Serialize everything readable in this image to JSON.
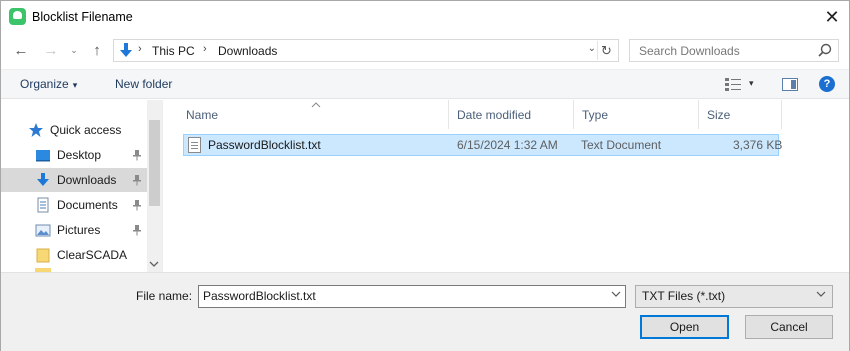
{
  "window": {
    "title": "Blocklist Filename",
    "close_glyph": "✕"
  },
  "nav": {
    "back_glyph": "←",
    "forward_glyph": "→",
    "up_glyph": "↑",
    "breadcrumb": [
      "This PC",
      "Downloads"
    ],
    "separator": "›",
    "refresh_glyph": "↻",
    "dropdown_glyph": "⌄"
  },
  "search": {
    "placeholder": "Search Downloads"
  },
  "toolbar": {
    "organize_label": "Organize",
    "new_folder_label": "New folder",
    "caret": "▾",
    "help_label": "?"
  },
  "sidebar": {
    "items": [
      {
        "label": "Quick access",
        "icon": "star-icon"
      },
      {
        "label": "Desktop",
        "icon": "desktop-icon",
        "pinned": true
      },
      {
        "label": "Downloads",
        "icon": "download-icon",
        "pinned": true,
        "selected": true
      },
      {
        "label": "Documents",
        "icon": "documents-icon",
        "pinned": true
      },
      {
        "label": "Pictures",
        "icon": "pictures-icon",
        "pinned": true
      },
      {
        "label": "ClearSCADA",
        "icon": "folder-icon"
      }
    ],
    "pin_glyph": "📌"
  },
  "filelist": {
    "columns": [
      "Name",
      "Date modified",
      "Type",
      "Size"
    ],
    "sort_glyph": "^",
    "rows": [
      {
        "name": "PasswordBlocklist.txt",
        "date": "6/15/2024 1:32 AM",
        "type": "Text Document",
        "size": "3,376 KB",
        "selected": true
      }
    ]
  },
  "footer": {
    "filename_label": "File name:",
    "filename_value": "PasswordBlocklist.txt",
    "filter_value": "TXT Files (*.txt)",
    "open_label": "Open",
    "cancel_label": "Cancel"
  },
  "colors": {
    "selection": "#cce8ff",
    "accent": "#0078d7",
    "app_icon": "#3cc46b"
  }
}
